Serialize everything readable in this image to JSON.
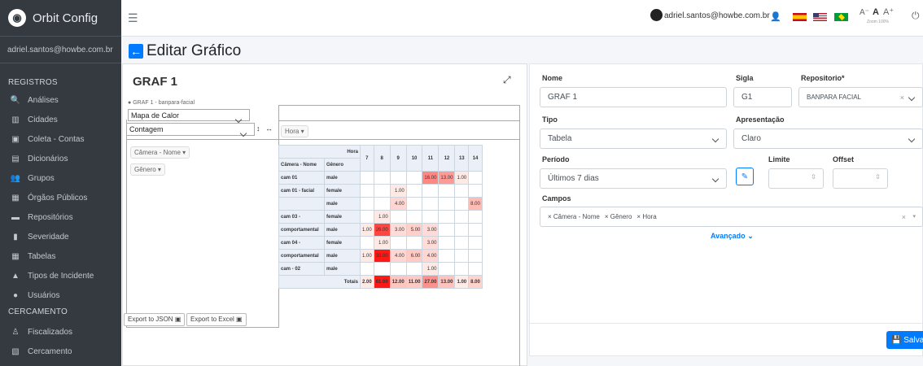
{
  "brand": {
    "name": "Orbit Config"
  },
  "sidebar": {
    "user": "adriel.santos@howbe.com.br",
    "section_registros": "REGISTROS",
    "items": [
      {
        "label": "Análises",
        "icon": "search-icon"
      },
      {
        "label": "Cidades",
        "icon": "city-icon"
      },
      {
        "label": "Coleta - Contas",
        "icon": "contacts-icon"
      },
      {
        "label": "Dicionários",
        "icon": "book-icon"
      },
      {
        "label": "Grupos",
        "icon": "users-icon"
      },
      {
        "label": "Órgãos Públicos",
        "icon": "building-icon"
      },
      {
        "label": "Repositórios",
        "icon": "folder-icon"
      },
      {
        "label": "Severidade",
        "icon": "thermometer-icon"
      },
      {
        "label": "Tabelas",
        "icon": "table-icon"
      },
      {
        "label": "Tipos de Incidente",
        "icon": "bell-icon"
      },
      {
        "label": "Usuários",
        "icon": "user-icon"
      }
    ],
    "section_cercamento": "CERCAMENTO",
    "items2": [
      {
        "label": "Fiscalizados",
        "icon": "person-walking-icon"
      },
      {
        "label": "Cercamento",
        "icon": "map-icon"
      }
    ]
  },
  "topbar": {
    "user_email": "adriel.santos@howbe.com.br",
    "font_small": "A⁻",
    "font_normal": "A",
    "font_large": "A⁺",
    "zoom": "Zoom 100%"
  },
  "page": {
    "title": "Editar Gráfico"
  },
  "graph": {
    "title": "GRAF 1",
    "subtitle": "GRAF 1 - banpara-facial",
    "renderer": "Mapa de Calor",
    "aggregator": "Contagem",
    "col_field": "Hora",
    "row_fields": [
      "Câmera - Nome",
      "Gênero"
    ],
    "hora_label": "Hora",
    "row_header_1": "Câmera - Nome",
    "row_header_2": "Gênero",
    "hours": [
      "7",
      "8",
      "9",
      "10",
      "11",
      "12",
      "13",
      "14"
    ],
    "rows": [
      {
        "cam": "cam 01",
        "gender": "male",
        "cells": [
          "",
          "",
          "",
          "",
          "16.00",
          "13.00",
          "1.00",
          ""
        ]
      },
      {
        "cam": "cam 01 - facial",
        "gender": "female",
        "cells": [
          "",
          "",
          "1.00",
          "",
          "",
          "",
          "",
          ""
        ]
      },
      {
        "cam": "",
        "gender": "male",
        "cells": [
          "",
          "",
          "4.00",
          "",
          "",
          "",
          "",
          "8.00"
        ]
      },
      {
        "cam": "cam 03 -",
        "gender": "female",
        "cells": [
          "",
          "1.00",
          "",
          "",
          "",
          "",
          "",
          ""
        ]
      },
      {
        "cam": "comportamental",
        "gender": "male",
        "cells": [
          "1.00",
          "26.00",
          "3.00",
          "5.00",
          "3.00",
          "",
          "",
          ""
        ]
      },
      {
        "cam": "cam 04 -",
        "gender": "female",
        "cells": [
          "",
          "1.00",
          "",
          "",
          "3.00",
          "",
          "",
          ""
        ]
      },
      {
        "cam": "comportamental",
        "gender": "male",
        "cells": [
          "1.00",
          "33.00",
          "4.00",
          "6.00",
          "4.00",
          "",
          "",
          ""
        ]
      },
      {
        "cam": "cam - 02",
        "gender": "male",
        "cells": [
          "",
          "",
          "",
          "",
          "1.00",
          "",
          "",
          ""
        ]
      }
    ],
    "totals_label": "Totais",
    "totals": [
      "2.00",
      "61.00",
      "12.00",
      "11.00",
      "27.00",
      "13.00",
      "1.00",
      "8.00"
    ],
    "export_json": "Export to JSON",
    "export_excel": "Export to Excel"
  },
  "form": {
    "nome_label": "Nome",
    "nome_value": "GRAF 1",
    "sigla_label": "Sigla",
    "sigla_value": "G1",
    "repo_label": "Repositorio*",
    "repo_value": "BANPARA FACIAL",
    "tipo_label": "Tipo",
    "tipo_value": "Tabela",
    "apres_label": "Apresentação",
    "apres_value": "Claro",
    "periodo_label": "Período",
    "periodo_value": "Últimos 7 dias",
    "limite_label": "Limite",
    "offset_label": "Offset",
    "campos_label": "Campos",
    "campos": [
      "Câmera - Nome",
      "Gênero",
      "Hora"
    ],
    "advanced": "Avançado",
    "save": "Salvar"
  },
  "colors": {
    "primary": "#007bff",
    "sidebar_bg": "#343a40",
    "heat_max": "#ff2d2d"
  }
}
